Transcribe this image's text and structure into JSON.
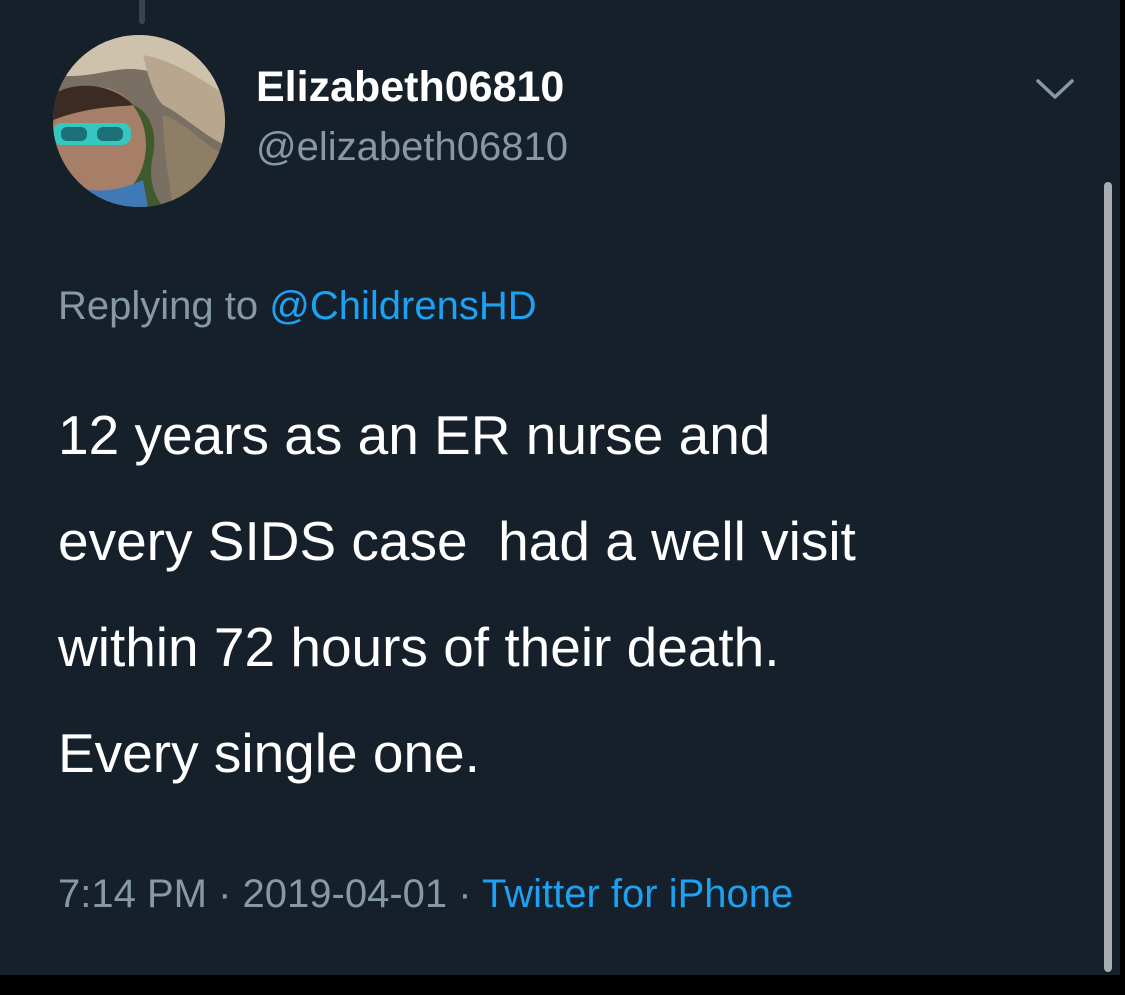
{
  "tweet": {
    "author": {
      "display_name": "Elizabeth06810",
      "handle": "@elizabeth06810"
    },
    "reply": {
      "prefix": "Replying to",
      "to_handle": "@ChildrensHD"
    },
    "text_lines": [
      "12 years as an ER nurse and",
      "every SIDS case  had a well visit",
      "within 72 hours of their death.",
      "Every single one."
    ],
    "time": "7:14 PM",
    "separator": "·",
    "date": "2019-04-01",
    "source": "Twitter for iPhone",
    "icons": {
      "menu": "chevron-down-icon",
      "avatar": "avatar"
    }
  },
  "theme": {
    "background": "#15202b",
    "text_primary": "#ffffff",
    "text_secondary": "#8899a6",
    "accent": "#1da1f2"
  }
}
